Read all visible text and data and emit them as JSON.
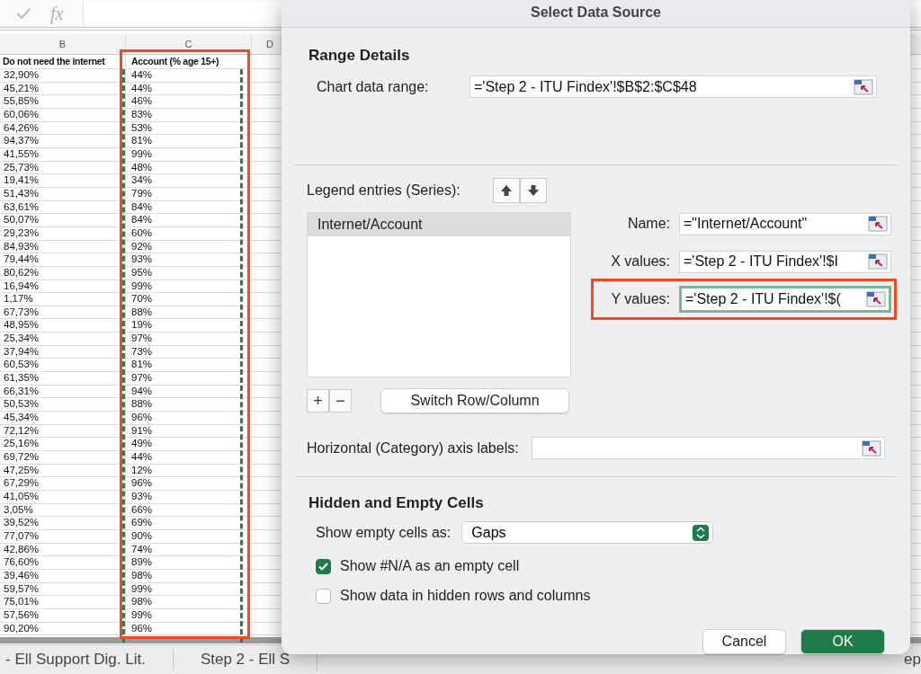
{
  "formula_bar": {
    "function_label": "fx"
  },
  "sheet": {
    "columns": [
      "B",
      "C",
      "D"
    ],
    "header": [
      "Do not need the internet",
      "Account (% age 15+)"
    ],
    "rows": [
      [
        "32,90%",
        "44%"
      ],
      [
        "45,21%",
        "44%"
      ],
      [
        "55,85%",
        "46%"
      ],
      [
        "60,06%",
        "83%"
      ],
      [
        "64,26%",
        "53%"
      ],
      [
        "94,37%",
        "81%"
      ],
      [
        "41,55%",
        "99%"
      ],
      [
        "25,73%",
        "48%"
      ],
      [
        "19,41%",
        "34%"
      ],
      [
        "51,43%",
        "79%"
      ],
      [
        "63,61%",
        "84%"
      ],
      [
        "50,07%",
        "84%"
      ],
      [
        "29,23%",
        "60%"
      ],
      [
        "84,93%",
        "92%"
      ],
      [
        "79,44%",
        "93%"
      ],
      [
        "80,62%",
        "95%"
      ],
      [
        "16,94%",
        "99%"
      ],
      [
        "1,17%",
        "70%"
      ],
      [
        "67,73%",
        "88%"
      ],
      [
        "48,95%",
        "19%"
      ],
      [
        "25,34%",
        "97%"
      ],
      [
        "37,94%",
        "73%"
      ],
      [
        "60,53%",
        "81%"
      ],
      [
        "61,35%",
        "97%"
      ],
      [
        "66,31%",
        "94%"
      ],
      [
        "50,53%",
        "88%"
      ],
      [
        "45,34%",
        "96%"
      ],
      [
        "72,12%",
        "91%"
      ],
      [
        "25,16%",
        "49%"
      ],
      [
        "69,72%",
        "44%"
      ],
      [
        "47,25%",
        "12%"
      ],
      [
        "67,29%",
        "96%"
      ],
      [
        "41,05%",
        "93%"
      ],
      [
        "3,05%",
        "66%"
      ],
      [
        "39,52%",
        "69%"
      ],
      [
        "77,07%",
        "90%"
      ],
      [
        "42,86%",
        "74%"
      ],
      [
        "76,60%",
        "89%"
      ],
      [
        "39,46%",
        "98%"
      ],
      [
        "59,57%",
        "99%"
      ],
      [
        "75,01%",
        "98%"
      ],
      [
        "57,56%",
        "99%"
      ],
      [
        "90,20%",
        "96%"
      ]
    ]
  },
  "sheet_tabs": [
    {
      "label": "- Ell Support Dig. Lit.",
      "selected": false
    },
    {
      "label": "Step 2 - Ell S",
      "selected": false
    },
    {
      "label": "ep",
      "selected": false
    }
  ],
  "dialog": {
    "title": "Select Data Source",
    "range_details": {
      "heading": "Range Details",
      "label": "Chart data range:",
      "value": "='Step 2 - ITU Findex'!$B$2:$C$48"
    },
    "legend": {
      "label": "Legend entries (Series):",
      "series": [
        {
          "name": "Internet/Account",
          "selected": true
        }
      ],
      "add": "+",
      "remove": "−",
      "switch": "Switch Row/Column"
    },
    "series_fields": [
      {
        "label": "Name:",
        "value": "=\"Internet/Account\"",
        "focused": false
      },
      {
        "label": "X values:",
        "value": "='Step 2 - ITU Findex'!$I",
        "focused": false
      },
      {
        "label": "Y values:",
        "value": "='Step 2 - ITU Findex'!$(",
        "focused": true
      }
    ],
    "axis_labels": {
      "label": "Horizontal (Category) axis labels:"
    },
    "hidden_empty": {
      "heading": "Hidden and Empty Cells",
      "label": "Show empty cells as:",
      "value": "Gaps",
      "checkboxes": [
        {
          "label": "Show #N/A as an empty cell",
          "checked": true
        },
        {
          "label": "Show data in hidden rows and columns",
          "checked": false
        }
      ]
    },
    "buttons": [
      {
        "label": "Cancel",
        "kind": "secondary"
      },
      {
        "label": "OK",
        "kind": "primary"
      }
    ]
  }
}
